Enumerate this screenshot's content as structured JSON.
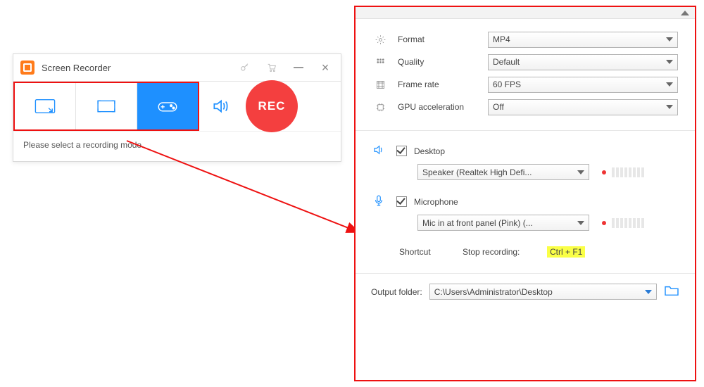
{
  "app": {
    "title": "Screen Recorder"
  },
  "toolbar": {
    "rec_label": "REC"
  },
  "status": {
    "message": "Please select a recording mode."
  },
  "settings": {
    "format": {
      "label": "Format",
      "value": "MP4"
    },
    "quality": {
      "label": "Quality",
      "value": "Default"
    },
    "fps": {
      "label": "Frame rate",
      "value": "60 FPS"
    },
    "gpu": {
      "label": "GPU acceleration",
      "value": "Off"
    }
  },
  "audio": {
    "desktop": {
      "label": "Desktop",
      "checked": true,
      "device": "Speaker (Realtek High Defi..."
    },
    "mic": {
      "label": "Microphone",
      "checked": true,
      "device": "Mic in at front panel (Pink) (..."
    }
  },
  "shortcut": {
    "label": "Shortcut",
    "stop_label": "Stop recording:",
    "hotkey": "Ctrl + F1"
  },
  "output": {
    "label": "Output folder:",
    "path": "C:\\Users\\Administrator\\Desktop"
  }
}
